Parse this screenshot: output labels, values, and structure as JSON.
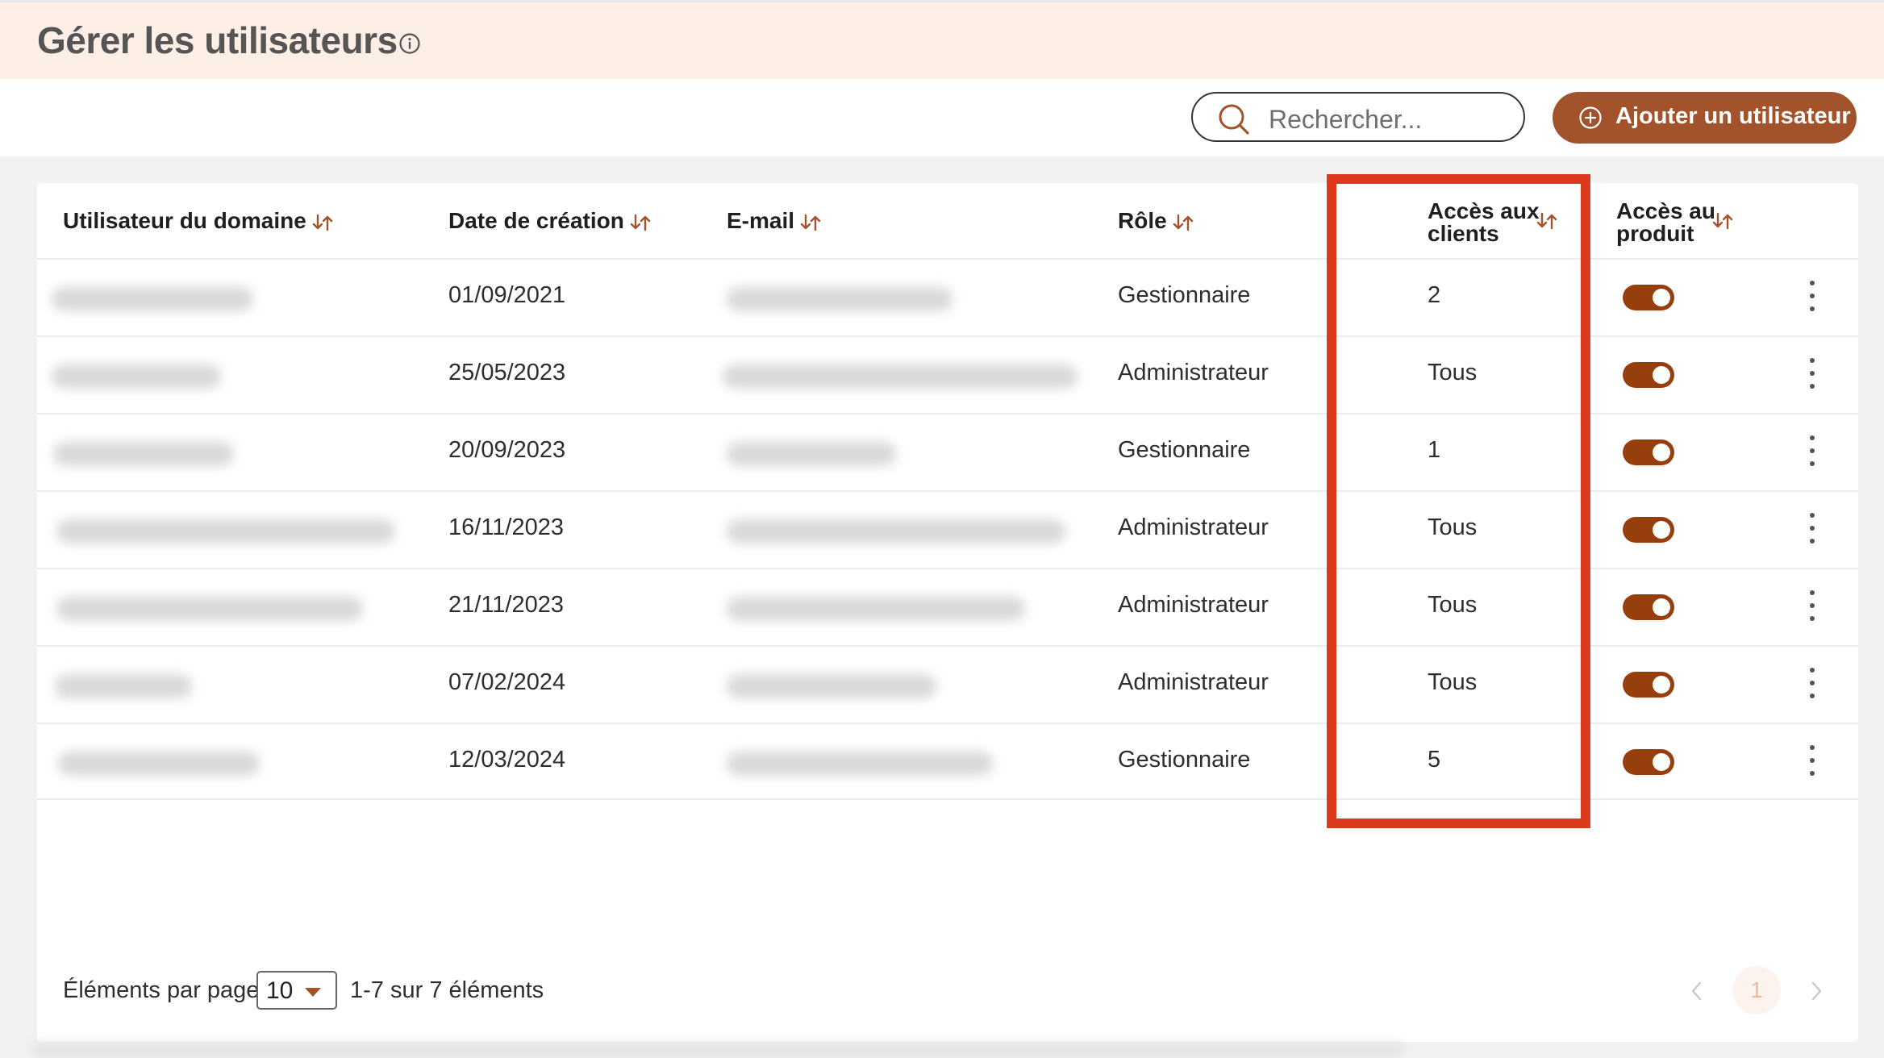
{
  "header": {
    "title": "Gérer les utilisateurs",
    "info_icon": "info-circle-icon"
  },
  "toolbar": {
    "search_placeholder": "Rechercher...",
    "add_button_label": "Ajouter un utilisateur",
    "accent_color": "#a2532b"
  },
  "table": {
    "columns": {
      "user": "Utilisateur du domaine",
      "created": "Date de création",
      "email": "E-mail",
      "role": "Rôle",
      "client_access_line1": "Accès aux",
      "client_access_line2": "clients",
      "product_access_line1": "Accès au",
      "product_access_line2": "produit"
    },
    "rows": [
      {
        "created": "01/09/2021",
        "role": "Gestionnaire",
        "client_access": "2",
        "product_access": true
      },
      {
        "created": "25/05/2023",
        "role": "Administrateur",
        "client_access": "Tous",
        "product_access": true
      },
      {
        "created": "20/09/2023",
        "role": "Gestionnaire",
        "client_access": "1",
        "product_access": true
      },
      {
        "created": "16/11/2023",
        "role": "Administrateur",
        "client_access": "Tous",
        "product_access": true
      },
      {
        "created": "21/11/2023",
        "role": "Administrateur",
        "client_access": "Tous",
        "product_access": true
      },
      {
        "created": "07/02/2024",
        "role": "Administrateur",
        "client_access": "Tous",
        "product_access": true
      },
      {
        "created": "12/03/2024",
        "role": "Gestionnaire",
        "client_access": "5",
        "product_access": true
      }
    ],
    "toggle_color": "#963f0c",
    "highlight_color": "#db3a1d"
  },
  "pagination": {
    "items_per_page_label": "Éléments par page",
    "page_size": "10",
    "range_label": "1-7 sur 7 éléments",
    "current_page": "1"
  }
}
